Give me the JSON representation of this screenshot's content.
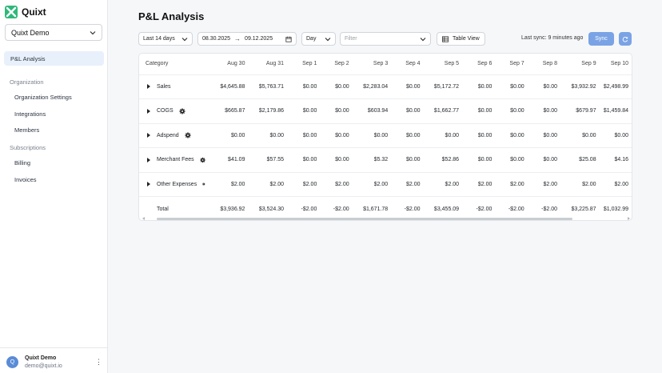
{
  "app": {
    "name": "Quixt"
  },
  "sidebar": {
    "org": "Quixt Demo",
    "active_item": "P&L Analysis",
    "sections": [
      {
        "title": "Organization",
        "items": [
          "Organization Settings",
          "Integrations",
          "Members"
        ]
      },
      {
        "title": "Subscriptions",
        "items": [
          "Billing",
          "Invoices"
        ]
      }
    ],
    "user": {
      "initial": "Q",
      "name": "Quixt Demo",
      "email": "demo@quixt.io"
    }
  },
  "page": {
    "title": "P&L Analysis"
  },
  "toolbar": {
    "range": "Last 14 days",
    "date_from": "08.30.2025",
    "date_to": "09.12.2025",
    "granularity": "Day",
    "filter_placeholder": "Filter",
    "table_view_label": "Table View",
    "last_sync": "Last sync: 9 minutes ago",
    "sync_label": "Sync"
  },
  "colors": {
    "accent": "#7aa3e5",
    "active_nav_bg": "#e8f0fb"
  },
  "table": {
    "category_header": "Category",
    "columns": [
      "Aug 30",
      "Aug 31",
      "Sep 1",
      "Sep 2",
      "Sep 3",
      "Sep 4",
      "Sep 5",
      "Sep 6",
      "Sep 7",
      "Sep 8",
      "Sep 9",
      "Sep 10"
    ],
    "rows": [
      {
        "label": "Sales",
        "expandable": true,
        "settings": false,
        "values": [
          "$4,645.88",
          "$5,763.71",
          "$0.00",
          "$0.00",
          "$2,283.04",
          "$0.00",
          "$5,172.72",
          "$0.00",
          "$0.00",
          "$0.00",
          "$3,932.92",
          "$2,498.99"
        ]
      },
      {
        "label": "COGS",
        "expandable": true,
        "settings": true,
        "values": [
          "$665.87",
          "$2,179.86",
          "$0.00",
          "$0.00",
          "$603.94",
          "$0.00",
          "$1,662.77",
          "$0.00",
          "$0.00",
          "$0.00",
          "$679.97",
          "$1,459.84"
        ]
      },
      {
        "label": "Adspend",
        "expandable": true,
        "settings": true,
        "values": [
          "$0.00",
          "$0.00",
          "$0.00",
          "$0.00",
          "$0.00",
          "$0.00",
          "$0.00",
          "$0.00",
          "$0.00",
          "$0.00",
          "$0.00",
          "$0.00"
        ]
      },
      {
        "label": "Merchant Fees",
        "expandable": true,
        "settings": true,
        "values": [
          "$41.09",
          "$57.55",
          "$0.00",
          "$0.00",
          "$5.32",
          "$0.00",
          "$52.86",
          "$0.00",
          "$0.00",
          "$0.00",
          "$25.08",
          "$4.16"
        ]
      },
      {
        "label": "Other Expenses",
        "expandable": true,
        "settings": true,
        "values": [
          "$2.00",
          "$2.00",
          "$2.00",
          "$2.00",
          "$2.00",
          "$2.00",
          "$2.00",
          "$2.00",
          "$2.00",
          "$2.00",
          "$2.00",
          "$2.00"
        ]
      },
      {
        "label": "Total",
        "expandable": false,
        "settings": false,
        "values": [
          "$3,936.92",
          "$3,524.30",
          "-$2.00",
          "-$2.00",
          "$1,671.78",
          "-$2.00",
          "$3,455.09",
          "-$2.00",
          "-$2.00",
          "-$2.00",
          "$3,225.87",
          "$1,032.99"
        ]
      }
    ]
  }
}
